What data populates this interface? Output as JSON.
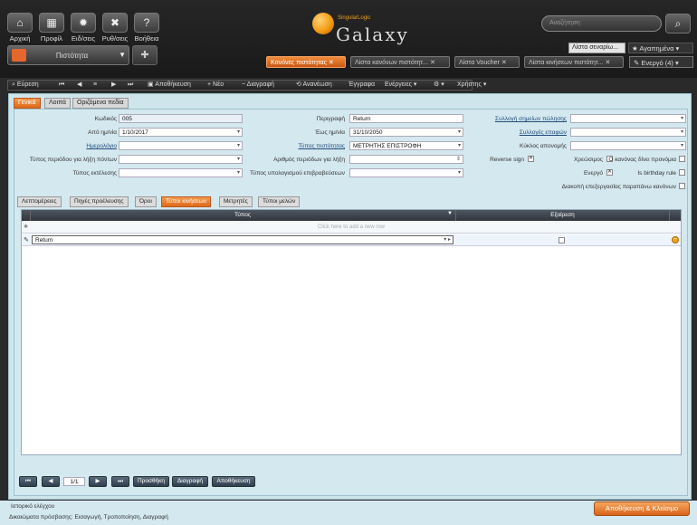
{
  "toolbar_top": {
    "buttons": [
      {
        "label": "Αρχική",
        "icon": "home-icon",
        "glyph": "⌂"
      },
      {
        "label": "Προφίλ",
        "icon": "profile-icon",
        "glyph": "▦"
      },
      {
        "label": "Ειδ/σεις",
        "icon": "notifications-icon",
        "glyph": "✹"
      },
      {
        "label": "Ρυθ/σεις",
        "icon": "settings-tools-icon",
        "glyph": "✖"
      },
      {
        "label": "Βοήθεια",
        "icon": "help-icon",
        "glyph": "?"
      }
    ],
    "module_selector": "Πιστότητα",
    "search_placeholder": "Αναζήτηση",
    "scenarios": "Λίστα σεναρίω...",
    "favorites": "★ Αγαπημένα ▾"
  },
  "logo": {
    "brand": "SingularLogic",
    "name": "Galaxy"
  },
  "open_tabs": [
    {
      "label": "Κανόνες πιστότητας",
      "active": true
    },
    {
      "label": "Λίστα κανόνων πιστότητ...",
      "active": false
    },
    {
      "label": "Λίστα Voucher",
      "active": false
    },
    {
      "label": "Λίστα κινήσεων πιστότητ...",
      "active": false
    }
  ],
  "active_count": "Ενεργό (4)",
  "action_toolbar": {
    "search": "Εύρεση",
    "save": "Αποθήκευση",
    "new": "Νέο",
    "delete": "Διαγραφή",
    "refresh": "Ανανέωση",
    "documents": "Έγγραφα",
    "actions": "Ενέργειες",
    "user": "Χρήστης"
  },
  "main_tabs": [
    "Γενικά",
    "Λοιπά",
    "Οριζόμενα πεδία"
  ],
  "form": {
    "code_label": "Κωδικός",
    "code_value": "005",
    "from_date_label": "Από ημ/νία",
    "from_date_value": "1/10/2017",
    "calendar_label": "Ημερολόγιο",
    "period_type_label": "Τύπος περιόδου για λήξη πόντων",
    "exec_type_label": "Τύπος εκτέλεσης",
    "description_label": "Περιγραφή",
    "description_value": "Return",
    "to_date_label": "Έως ημ/νία",
    "to_date_value": "31/10/2050",
    "loyalty_type_label": "Τύπος πιστότητας",
    "loyalty_type_value": "ΜΕΤΡΗΤΗΣ ΕΠΙΣΤΡΟΦΗ",
    "periods_label": "Αριθμός περιόδων για λήξη",
    "reward_calc_label": "Τύπος υπολογισμού επιβραβεύσεων",
    "points_collection_label": "Συλλογή σημείων πώλησης",
    "contacts_collection_label": "Συλλογές επαφών",
    "inventory_cycle_label": "Κύκλος απονομής",
    "reverse_sign_label": "Reverse sign",
    "debit_label": "Χρεώσιμος",
    "is_default_label": "Ο κανόνας δίνει προνόμια",
    "active_label": "Ενεργό",
    "birthday_label": "Is birthday rule",
    "stop_label": "Διακοπή επεξεργασίας παραπάνω κανόνων"
  },
  "sub_tabs": [
    "Λεπτομέρειες",
    "Πηγές προέλευσης",
    "Όροι",
    "Τύποι κινήσεων",
    "Μετρητές",
    "Τύποι μελών"
  ],
  "grid": {
    "col_type": "Τύπος",
    "col_exclusion": "Εξαίρεση",
    "add_row": "Click here to add a new row",
    "rows": [
      {
        "type": "Return",
        "excluded": false
      }
    ]
  },
  "pager": {
    "page": "1/1",
    "add": "Προσθήκη",
    "delete": "Διαγραφή",
    "save": "Αποθήκευση"
  },
  "footer": {
    "history": "Ιστορικό ελέγχου",
    "rights": "Δικαιώματα πρόσβασης: Εισαγωγή, Τροποποίηση, Διαγραφή",
    "save_close": "Αποθήκευση & Κλείσιμο"
  }
}
